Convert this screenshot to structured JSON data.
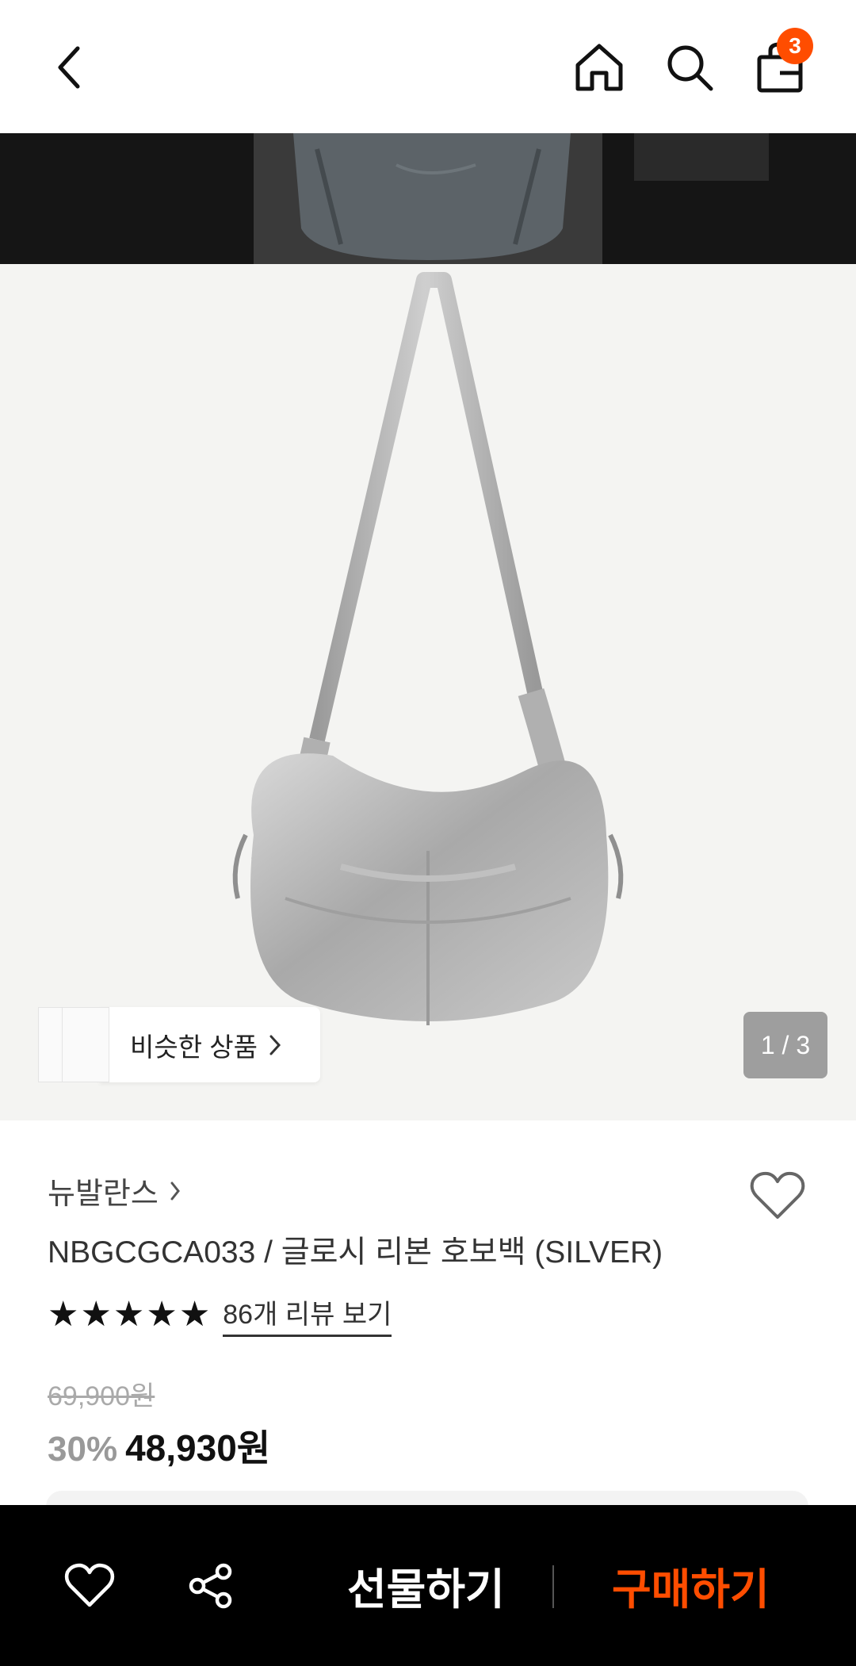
{
  "header": {
    "back_icon": "chevron-left-icon",
    "home_icon": "home-icon",
    "search_icon": "search-icon",
    "cart_icon": "shopping-bag-icon",
    "cart_count": "3"
  },
  "gallery": {
    "similar_label": "비슷한 상품",
    "page_indicator": "1 / 3"
  },
  "product": {
    "brand": "뉴발란스",
    "title": "NBGCGCA033 / 글로시 리본 호보백 (SILVER)",
    "rating": 5,
    "reviews_label": "86개 리뷰 보기",
    "original_price": "69,900원",
    "discount": "30%",
    "sale_price": "48,930원"
  },
  "bottom_bar": {
    "gift_label": "선물하기",
    "buy_label": "구매하기"
  },
  "colors": {
    "accent": "#ff4d00",
    "bottom_bar_bg": "#000000"
  }
}
